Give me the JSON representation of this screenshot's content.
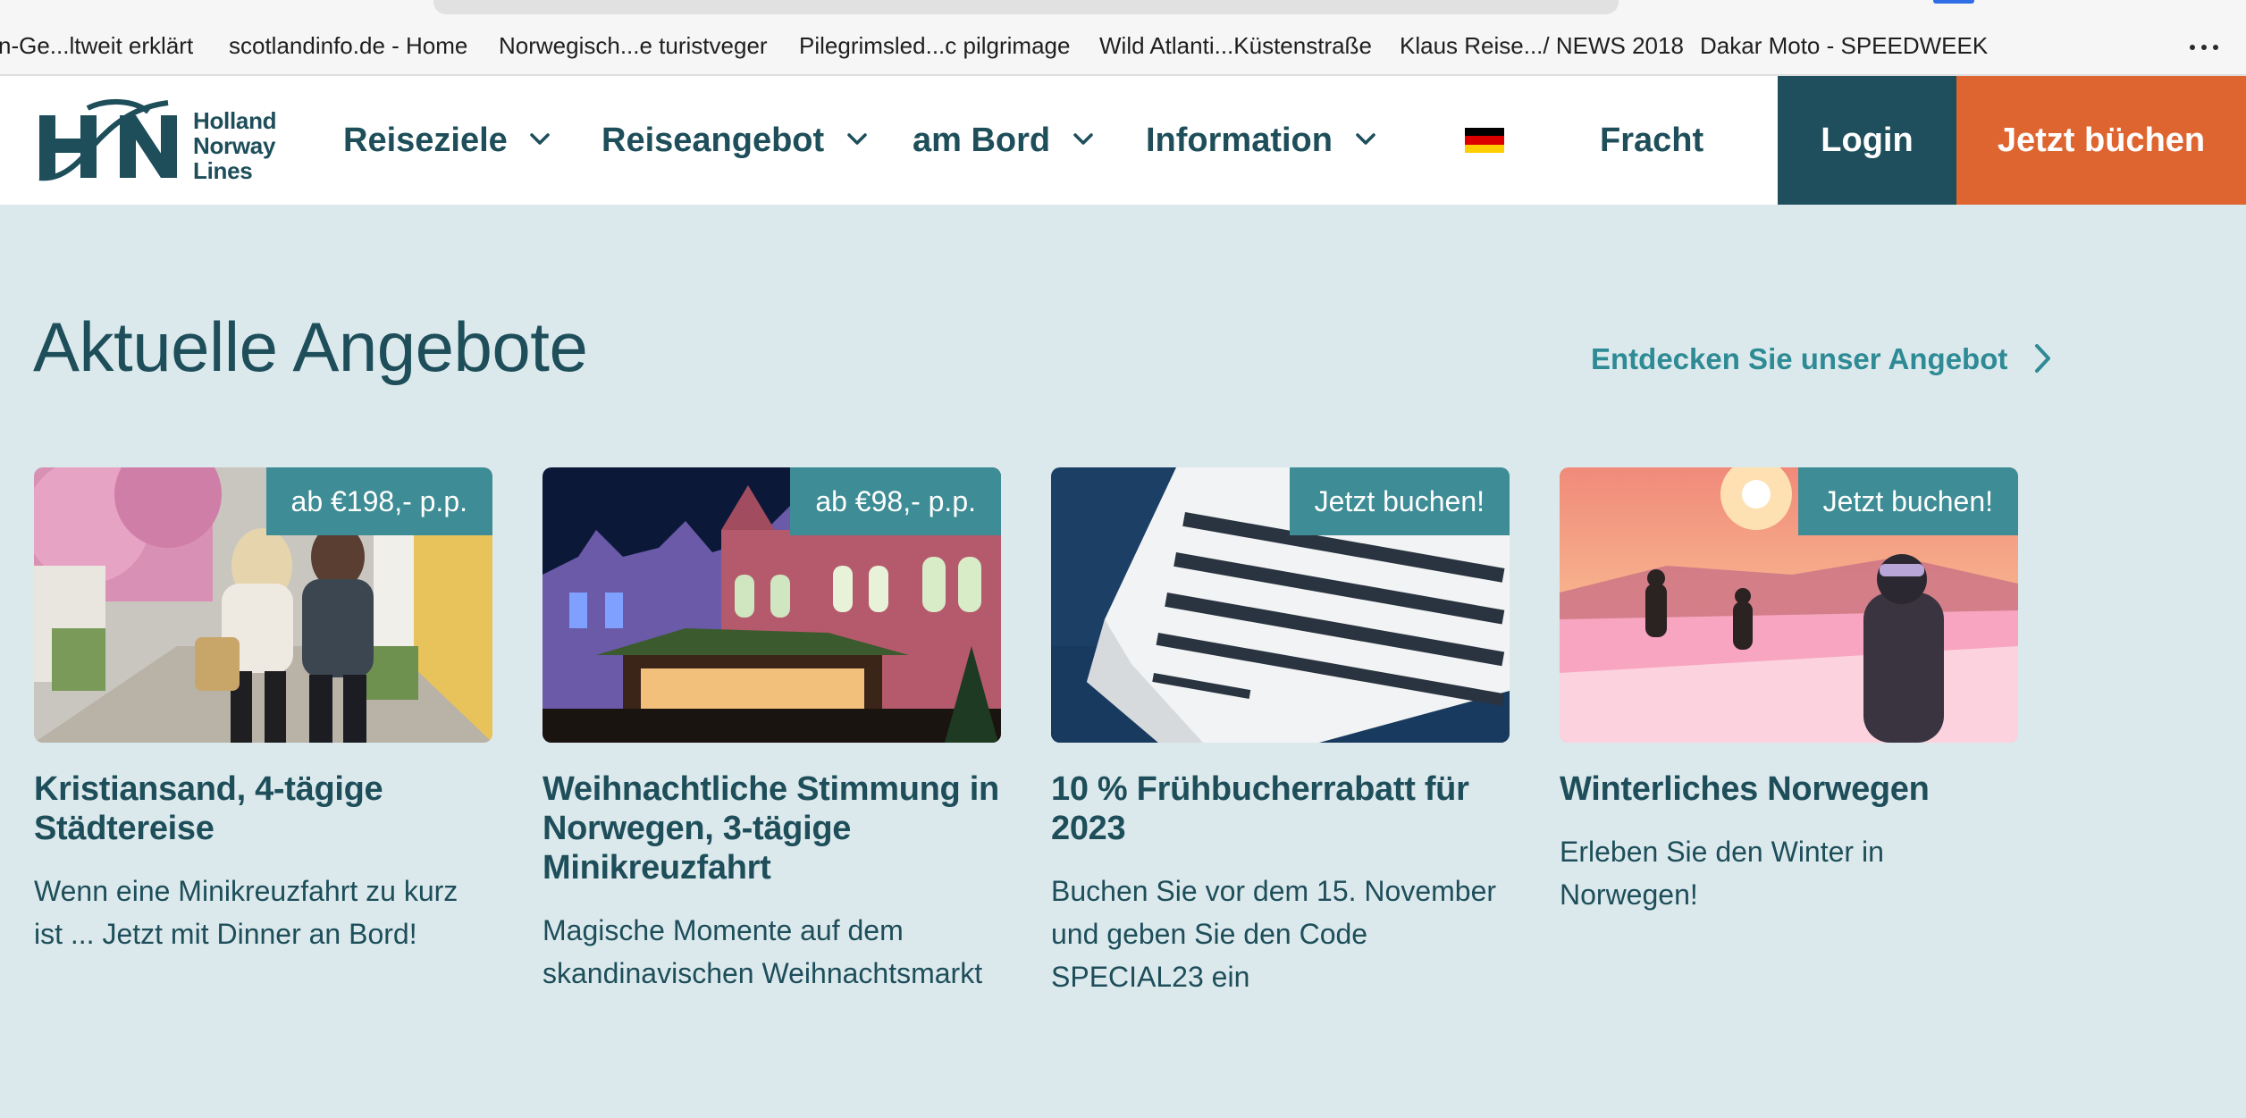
{
  "bookmarks": [
    "n-Ge...ltweit erklärt",
    "scotlandinfo.de - Home",
    "Norwegisch...e turistveger",
    "Pilegrimsled...c pilgrimage",
    "Wild Atlanti...Küstenstraße",
    "Klaus Reise.../ NEWS 2018",
    "Dakar Moto - SPEEDWEEK"
  ],
  "header": {
    "logo_lines": [
      "Holland",
      "Norway",
      "Lines"
    ],
    "nav": [
      {
        "label": "Reiseziele",
        "icon": "chevron-down-icon"
      },
      {
        "label": "Reiseangebot",
        "icon": "chevron-down-icon"
      },
      {
        "label": "am Bord",
        "icon": "chevron-down-icon"
      },
      {
        "label": "Information",
        "icon": "chevron-down-icon"
      }
    ],
    "flag_icon": "german-flag-icon",
    "fracht": "Fracht",
    "login": "Login",
    "book": "Jetzt büchen"
  },
  "main": {
    "title": "Aktuelle Angebote",
    "discover_link": "Entdecken Sie unser Angebot",
    "cards": [
      {
        "badge": "ab €198,- p.p.",
        "title": "Kristiansand, 4-tägige Städtereise",
        "desc": "Wenn eine Minikreuzfahrt zu kurz ist ... Jetzt mit Dinner an Bord!"
      },
      {
        "badge": "ab €98,- p.p.",
        "title": "Weihnachtliche Stimmung in Norwegen, 3-tägige Minikreuzfahrt",
        "desc": "Magische Momente auf dem skandinavischen Weihnachtsmarkt"
      },
      {
        "badge": "Jetzt buchen!",
        "title": "10 % Frühbucherrabatt für 2023",
        "desc": "Buchen Sie vor dem 15. November und geben Sie den Code SPECIAL23 ein"
      },
      {
        "badge": "Jetzt buchen!",
        "title": "Winterliches Norwegen",
        "desc": "Erleben Sie den Winter in Norwegen!"
      }
    ]
  },
  "colors": {
    "brand_dark": "#1d4e5a",
    "login_bg": "#1f4f5c",
    "book_bg": "#df6530",
    "badge_bg": "#3e8c95",
    "page_bg": "#dce9ec",
    "link": "#2e8a95"
  }
}
